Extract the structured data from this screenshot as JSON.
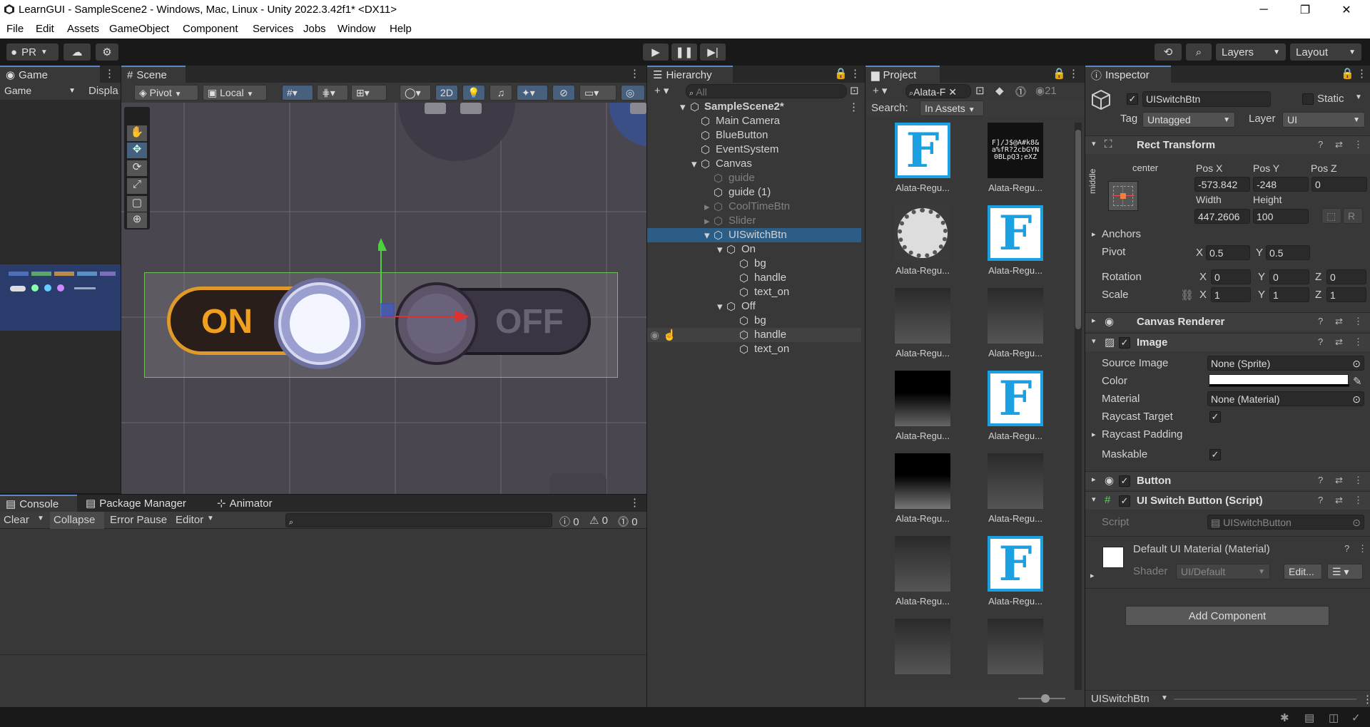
{
  "window": {
    "title": "LearnGUI - SampleScene2 - Windows, Mac, Linux - Unity 2022.3.42f1* <DX11>"
  },
  "menu": [
    "File",
    "Edit",
    "Assets",
    "GameObject",
    "Component",
    "Services",
    "Jobs",
    "Window",
    "Help"
  ],
  "toolbar": {
    "account": "PR",
    "layers": "Layers",
    "layout": "Layout"
  },
  "game": {
    "tab": "Game",
    "display_dropdown": "Game",
    "display_label": "Displa"
  },
  "scene": {
    "tab": "Scene",
    "pivot": "Pivot",
    "local": "Local",
    "mode_2d": "2D",
    "on_label": "ON",
    "off_label": "OFF"
  },
  "hierarchy": {
    "tab": "Hierarchy",
    "search_placeholder": "All",
    "items": [
      {
        "label": "SampleScene2*"
      },
      {
        "label": "Main Camera"
      },
      {
        "label": "BlueButton"
      },
      {
        "label": "EventSystem"
      },
      {
        "label": "Canvas"
      },
      {
        "label": "guide"
      },
      {
        "label": "guide (1)"
      },
      {
        "label": "CoolTimeBtn"
      },
      {
        "label": "Slider"
      },
      {
        "label": "UISwitchBtn"
      },
      {
        "label": "On"
      },
      {
        "label": "bg"
      },
      {
        "label": "handle"
      },
      {
        "label": "text_on"
      },
      {
        "label": "Off"
      },
      {
        "label": "bg"
      },
      {
        "label": "handle"
      },
      {
        "label": "text_on"
      }
    ]
  },
  "project": {
    "tab": "Project",
    "search_value": "Alata-F",
    "search_label": "Search:",
    "search_scope": "In Assets",
    "visibility_count": "21",
    "assets": [
      {
        "label": "Alata-Regu..."
      },
      {
        "label": "Alata-Regu..."
      },
      {
        "label": "Alata-Regu..."
      },
      {
        "label": "Alata-Regu..."
      },
      {
        "label": "Alata-Regu..."
      },
      {
        "label": "Alata-Regu..."
      },
      {
        "label": "Alata-Regu..."
      },
      {
        "label": "Alata-Regu..."
      },
      {
        "label": "Alata-Regu..."
      },
      {
        "label": "Alata-Regu..."
      },
      {
        "label": "Alata-Regu..."
      },
      {
        "label": "Alata-Regu..."
      }
    ]
  },
  "console": {
    "tabs": [
      "Console",
      "Package Manager",
      "Animator"
    ],
    "clear": "Clear",
    "collapse": "Collapse",
    "error_pause": "Error Pause",
    "editor": "Editor",
    "count_log": "0",
    "count_warn": "0",
    "count_error": "0"
  },
  "inspector": {
    "tab": "Inspector",
    "object_name": "UISwitchBtn",
    "static_label": "Static",
    "tag_label": "Tag",
    "tag_value": "Untagged",
    "layer_label": "Layer",
    "layer_value": "UI",
    "rect_transform": {
      "title": "Rect Transform",
      "anchor_h": "center",
      "anchor_v": "middle",
      "pos_x_label": "Pos X",
      "pos_y_label": "Pos Y",
      "pos_z_label": "Pos Z",
      "pos_x": "-573.842",
      "pos_y": "-248",
      "pos_z": "0",
      "width_label": "Width",
      "height_label": "Height",
      "width": "447.2606",
      "height": "100",
      "anchors": "Anchors",
      "pivot_label": "Pivot",
      "pivot_x": "0.5",
      "pivot_y": "0.5",
      "rotation_label": "Rotation",
      "rot_x": "0",
      "rot_y": "0",
      "rot_z": "0",
      "scale_label": "Scale",
      "scale_x": "1",
      "scale_y": "1",
      "scale_z": "1",
      "x": "X",
      "y": "Y",
      "z": "Z"
    },
    "canvas_renderer": "Canvas Renderer",
    "image": {
      "title": "Image",
      "source_image_label": "Source Image",
      "source_image": "None (Sprite)",
      "color_label": "Color",
      "material_label": "Material",
      "material": "None (Material)",
      "raycast_target": "Raycast Target",
      "raycast_padding": "Raycast Padding",
      "maskable": "Maskable"
    },
    "button": "Button",
    "script_comp": {
      "title": "UI Switch Button (Script)",
      "script_label": "Script",
      "script_value": "UISwitchButton"
    },
    "material_block": {
      "name": "Default UI Material (Material)",
      "shader_label": "Shader",
      "shader_value": "UI/Default",
      "edit": "Edit..."
    },
    "add_component": "Add Component",
    "footer": "UISwitchBtn"
  },
  "colors": {
    "accent": "#5c87c5",
    "selection": "#2c5d87",
    "panel": "#383838"
  }
}
